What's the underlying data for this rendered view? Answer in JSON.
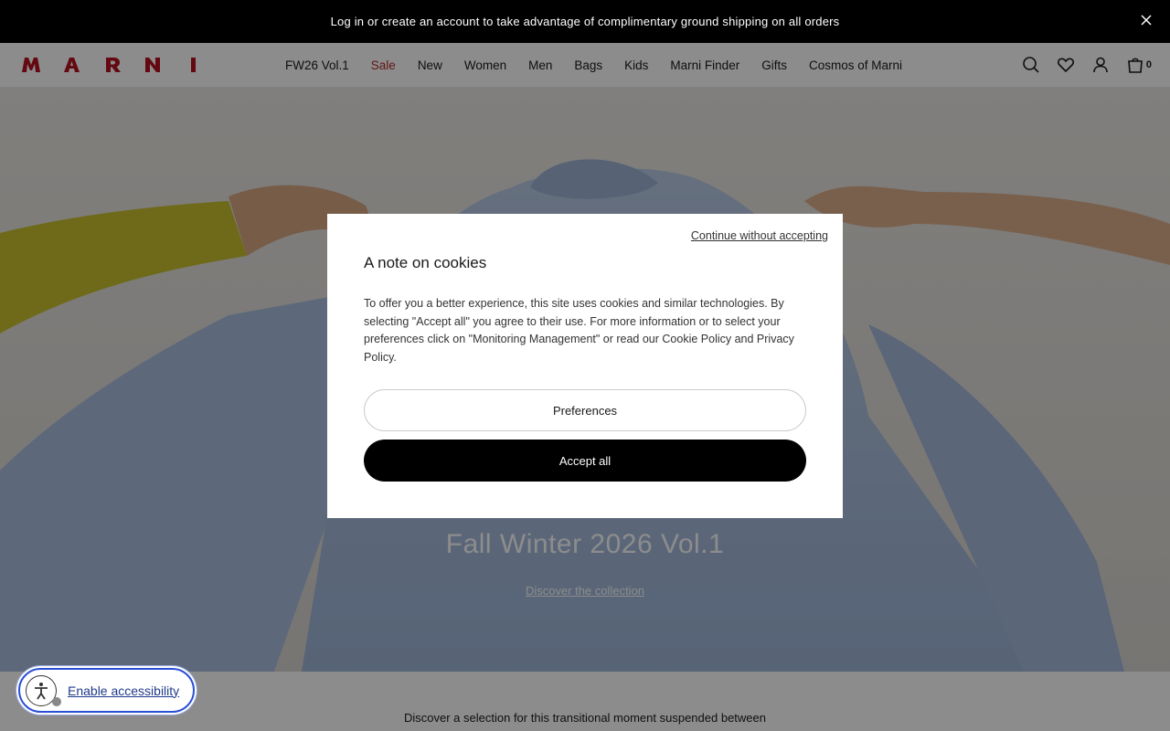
{
  "promo": {
    "text": "Log in or create an account to take advantage of complimentary ground shipping on all orders",
    "close_icon": "close-icon"
  },
  "header": {
    "logo_text": "MARNI",
    "nav": [
      "FW26 Vol.1",
      "Sale",
      "New",
      "Women",
      "Men",
      "Bags",
      "Kids",
      "Marni Finder",
      "Gifts",
      "Cosmos of Marni"
    ],
    "icons": [
      "search-icon",
      "heart-icon",
      "user-icon",
      "bag-icon"
    ],
    "cart_count": "0",
    "sale_color": "#b22a2a"
  },
  "hero": {
    "title": "Fall Winter 2026 Vol.1",
    "link": "Discover the collection"
  },
  "below": {
    "text": "Discover a selection for this transitional moment suspended between"
  },
  "cookie_modal": {
    "skip": "Continue without accepting",
    "title": "A note on cookies",
    "body": "To offer you a better experience, this site uses cookies and similar technologies. By selecting \"Accept all\" you agree to their use. For more information or to select your preferences click on \"Monitoring Management\" or read our Cookie Policy and Privacy Policy.",
    "preferences": "Preferences",
    "accept": "Accept all"
  },
  "accessibility": {
    "label": "Enable accessibility",
    "icon": "accessibility-icon"
  }
}
